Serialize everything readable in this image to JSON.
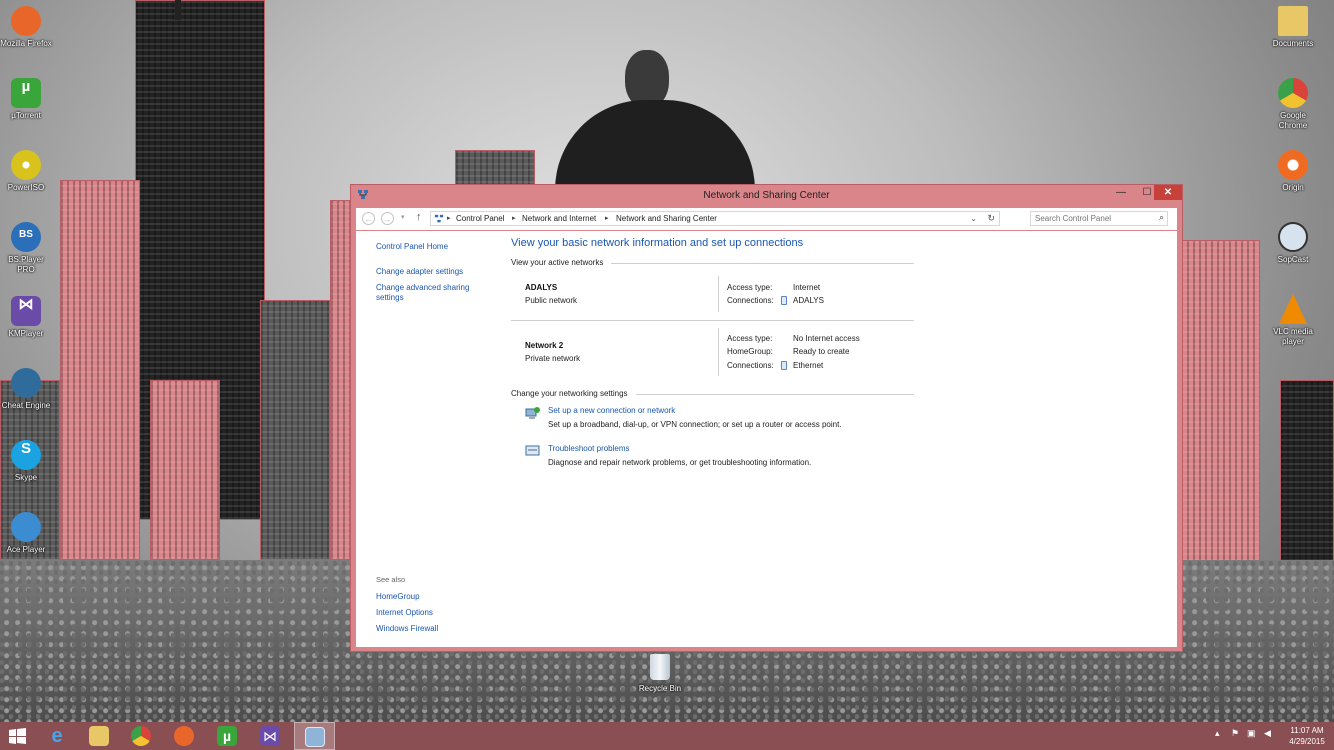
{
  "desktop": {
    "icons_left": [
      {
        "label": "Mozilla Firefox",
        "icon": "firefox-icon",
        "color": "#e8662a"
      },
      {
        "label": "µTorrent",
        "icon": "utorrent-icon",
        "color": "#3aa53a"
      },
      {
        "label": "PowerISO",
        "icon": "poweriso-icon",
        "color": "#d8c21c"
      },
      {
        "label": "BS.Player PRO",
        "icon": "bsplayer-icon",
        "color": "#2a6fb8"
      },
      {
        "label": "KMPlayer",
        "icon": "kmplayer-icon",
        "color": "#6a4ca8"
      },
      {
        "label": "Cheat Engine",
        "icon": "cheatengine-icon",
        "color": "#2f6c9c"
      },
      {
        "label": "Skype",
        "icon": "skype-icon",
        "color": "#1aa3e0"
      },
      {
        "label": "Ace Player",
        "icon": "aceplayer-icon",
        "color": "#3b8cd0"
      }
    ],
    "icons_right": [
      {
        "label": "Documents",
        "icon": "folder-icon",
        "color": "#e8c866"
      },
      {
        "label": "Google Chrome",
        "icon": "chrome-icon",
        "color": "#3aa04a"
      },
      {
        "label": "Origin",
        "icon": "origin-icon",
        "color": "#f06b22"
      },
      {
        "label": "SopCast",
        "icon": "sopcast-icon",
        "color": "#9cbbd6"
      },
      {
        "label": "VLC media player",
        "icon": "vlc-icon",
        "color": "#f08a00"
      }
    ],
    "recycle_bin": "Recycle Bin"
  },
  "window": {
    "title": "Network and Sharing Center",
    "buttons": {
      "minimize": "—",
      "maximize": "☐",
      "close": "✕"
    },
    "breadcrumbs": [
      "Control Panel",
      "Network and Internet",
      "Network and Sharing Center"
    ],
    "search_placeholder": "Search Control Panel",
    "left_nav": {
      "home": "Control Panel Home",
      "adapter": "Change adapter settings",
      "advanced_line1": "Change advanced sharing",
      "advanced_line2": "settings",
      "see_also": "See also",
      "see_also_links": [
        "HomeGroup",
        "Internet Options",
        "Windows Firewall"
      ]
    },
    "main": {
      "heading": "View your basic network information and set up connections",
      "active_networks_label": "View your active networks",
      "networks": [
        {
          "name": "ADALYS",
          "type": "Public network",
          "access_label": "Access type:",
          "access_value": "Internet",
          "connections_label": "Connections:",
          "connections_value": "ADALYS"
        },
        {
          "name": "Network  2",
          "type": "Private network",
          "access_label": "Access type:",
          "access_value": "No Internet access",
          "homegroup_label": "HomeGroup:",
          "homegroup_value": "Ready to create",
          "connections_label": "Connections:",
          "connections_value": "Ethernet"
        }
      ],
      "change_settings_label": "Change your networking settings",
      "tasks": [
        {
          "link": "Set up a new connection or network",
          "desc": "Set up a broadband, dial-up, or VPN connection; or set up a router or access point."
        },
        {
          "link": "Troubleshoot problems",
          "desc": "Diagnose and repair network problems, or get troubleshooting information."
        }
      ]
    }
  },
  "taskbar": {
    "color": "#8a4f53",
    "pinned": [
      "start-icon",
      "internet-explorer-icon",
      "file-explorer-icon",
      "chrome-icon",
      "firefox-icon",
      "utorrent-icon",
      "kmplayer-icon",
      "network-center-icon"
    ],
    "time": "11:07 AM",
    "date": "4/29/2015"
  }
}
